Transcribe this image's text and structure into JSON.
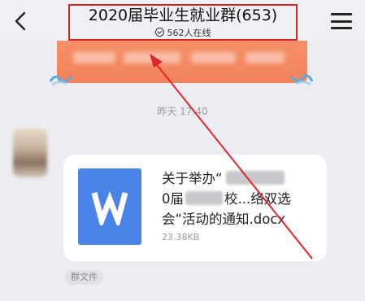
{
  "header": {
    "title": "2020届毕业生就业群(653)",
    "online_count": "562人在线",
    "back_icon": "chevron-left-icon",
    "menu_icon": "hamburger-menu-icon"
  },
  "timestamp": "昨天 17:40",
  "message": {
    "file": {
      "name_line1": "关于举办“",
      "name_line2_prefix": "0届",
      "name_line2_suffix": "校...络双选",
      "name_line3": "会“活动的通知.docx",
      "size": "23.38KB",
      "icon": "word-document-icon",
      "icon_letter": "W",
      "icon_color": "#4a84e8"
    },
    "source_tag": "群文件"
  },
  "colors": {
    "highlight": "#d8232a",
    "banner": "#f2825c",
    "background": "#ecedf3"
  }
}
